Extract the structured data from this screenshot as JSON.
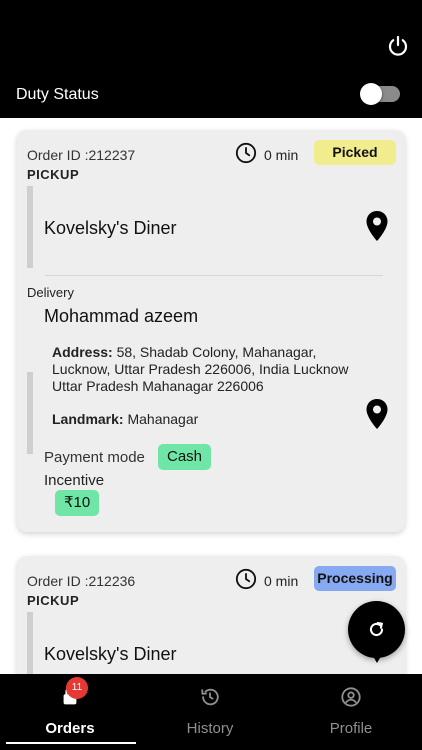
{
  "header": {
    "duty_label": "Duty Status",
    "duty_on": false,
    "power_icon": "power-icon"
  },
  "orders": [
    {
      "order_id": "Order ID :212237",
      "time": "0 min",
      "status": "Picked",
      "status_color": "#f1ec8e",
      "pickup_label": "PICKUP",
      "restaurant": "Kovelsky's Diner",
      "delivery_label": "Delivery",
      "customer": "Mohammad azeem",
      "address_label": "Address:",
      "address": " 58, Shadab Colony, Mahanagar, Lucknow, Uttar Pradesh 226006, India Lucknow Uttar Pradesh Mahanagar 226006",
      "landmark_label": "Landmark:",
      "landmark": " Mahanagar",
      "payment_label": "Payment mode",
      "payment_mode": "Cash",
      "incentive_label": "Incentive",
      "incentive": "₹10"
    },
    {
      "order_id": "Order ID :212236",
      "time": "0 min",
      "status": "Processing",
      "status_color": "#86a9f1",
      "pickup_label": "PICKUP",
      "restaurant": "Kovelsky's Diner"
    }
  ],
  "fab": {
    "icon": "refresh-icon"
  },
  "nav": {
    "items": [
      {
        "label": "Orders",
        "icon": "orders-icon",
        "active": true,
        "badge": "11"
      },
      {
        "label": "History",
        "icon": "history-icon",
        "active": false
      },
      {
        "label": "Profile",
        "icon": "profile-icon",
        "active": false
      }
    ]
  },
  "colors": {
    "badge_green": "#6fe6a6",
    "notification_red": "#e53935",
    "bar_black": "#000000"
  }
}
